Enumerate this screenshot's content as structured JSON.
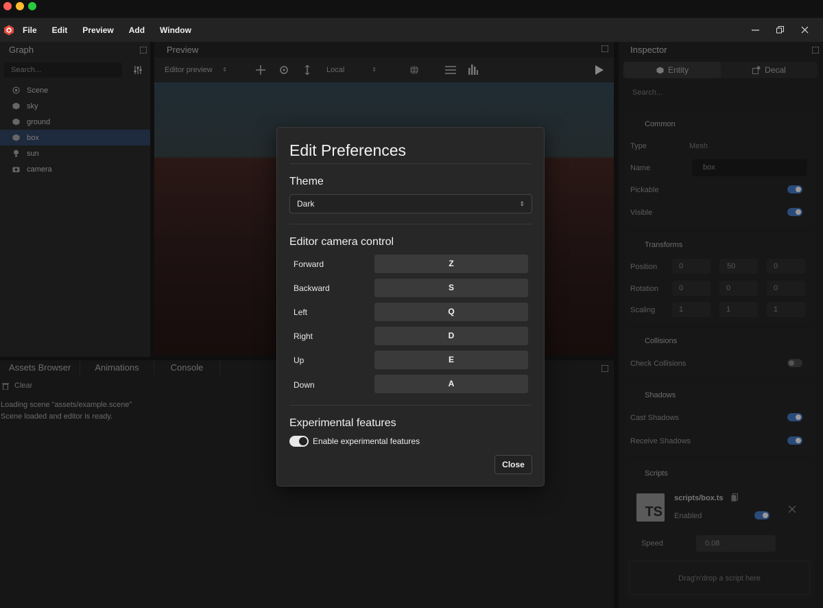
{
  "menu": [
    "File",
    "Edit",
    "Preview",
    "Add",
    "Window"
  ],
  "window_controls": [
    "minimize-icon",
    "restore-icon",
    "close-icon"
  ],
  "graph": {
    "title": "Graph",
    "search_placeholder": "Search...",
    "items": [
      {
        "label": "Scene",
        "icon": "scene-icon",
        "selected": false
      },
      {
        "label": "sky",
        "icon": "cube-icon",
        "selected": false
      },
      {
        "label": "ground",
        "icon": "cube-icon",
        "selected": false
      },
      {
        "label": "box",
        "icon": "cube-icon",
        "selected": true
      },
      {
        "label": "sun",
        "icon": "light-icon",
        "selected": false
      },
      {
        "label": "camera",
        "icon": "camera-icon",
        "selected": false
      }
    ]
  },
  "preview": {
    "title": "Preview",
    "camera_select": "Editor preview",
    "space_select": "Local"
  },
  "bottom": {
    "tabs": [
      "Assets Browser",
      "Animations",
      "Console"
    ],
    "clear_label": "Clear",
    "lines": [
      "Loading scene \"assets/example.scene\"",
      "Scene loaded and editor is ready."
    ]
  },
  "inspector": {
    "title": "Inspector",
    "tabs": [
      "Entity",
      "Decal"
    ],
    "search_placeholder": "Search...",
    "common": {
      "title": "Common",
      "type_label": "Type",
      "type_value": "Mesh",
      "name_label": "Name",
      "name_value": "box",
      "pickable_label": "Pickable",
      "visible_label": "Visible"
    },
    "transforms": {
      "title": "Transforms",
      "rows": [
        {
          "label": "Position",
          "values": [
            "0",
            "50",
            "0"
          ]
        },
        {
          "label": "Rotation",
          "values": [
            "0",
            "0",
            "0"
          ]
        },
        {
          "label": "Scaling",
          "values": [
            "1",
            "1",
            "1"
          ]
        }
      ]
    },
    "collisions": {
      "title": "Collisions",
      "check_label": "Check Collisions"
    },
    "shadows": {
      "title": "Shadows",
      "cast_label": "Cast Shadows",
      "receive_label": "Receive Shadows"
    },
    "scripts": {
      "title": "Scripts",
      "file": "scripts/box.ts",
      "badge": "TS",
      "enabled_label": "Enabled",
      "speed_label": "Speed",
      "speed_value": "0.08",
      "drop_hint": "Drag'n'drop a script here"
    }
  },
  "dialog": {
    "title": "Edit Preferences",
    "theme_heading": "Theme",
    "theme_value": "Dark",
    "camera_heading": "Editor camera control",
    "bindings": [
      {
        "action": "Forward",
        "key": "Z"
      },
      {
        "action": "Backward",
        "key": "S"
      },
      {
        "action": "Left",
        "key": "Q"
      },
      {
        "action": "Right",
        "key": "D"
      },
      {
        "action": "Up",
        "key": "E"
      },
      {
        "action": "Down",
        "key": "A"
      }
    ],
    "experimental_heading": "Experimental features",
    "experimental_toggle_label": "Enable experimental features",
    "experimental_enabled": true,
    "close_label": "Close"
  }
}
